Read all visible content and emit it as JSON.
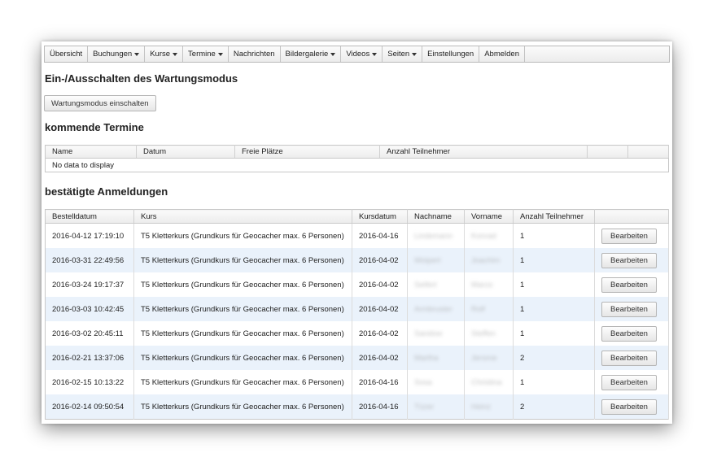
{
  "nav": {
    "items": [
      {
        "label": "Übersicht",
        "dropdown": false
      },
      {
        "label": "Buchungen",
        "dropdown": true
      },
      {
        "label": "Kurse",
        "dropdown": true
      },
      {
        "label": "Termine",
        "dropdown": true
      },
      {
        "label": "Nachrichten",
        "dropdown": false
      },
      {
        "label": "Bildergalerie",
        "dropdown": true
      },
      {
        "label": "Videos",
        "dropdown": true
      },
      {
        "label": "Seiten",
        "dropdown": true
      },
      {
        "label": "Einstellungen",
        "dropdown": false
      },
      {
        "label": "Abmelden",
        "dropdown": false
      }
    ]
  },
  "maintenance": {
    "heading": "Ein-/Ausschalten des Wartungsmodus",
    "button_label": "Wartungsmodus einschalten"
  },
  "upcoming": {
    "heading": "kommende Termine",
    "columns": [
      "Name",
      "Datum",
      "Freie Plätze",
      "Anzahl Teilnehmer",
      "",
      ""
    ],
    "empty_text": "No data to display"
  },
  "confirmed": {
    "heading": "bestätigte Anmeldungen",
    "columns": [
      "Bestelldatum",
      "Kurs",
      "Kursdatum",
      "Nachname",
      "Vorname",
      "Anzahl Teilnehmer",
      ""
    ],
    "action_label": "Bearbeiten",
    "rows": [
      {
        "bestelldatum": "2016-04-12 17:19:10",
        "kurs": "T5 Kletterkurs (Grundkurs für Geocacher max. 6 Personen)",
        "kursdatum": "2016-04-16",
        "nachname": "Lindemann",
        "vorname": "Konrad",
        "anzahl": "1"
      },
      {
        "bestelldatum": "2016-03-31 22:49:56",
        "kurs": "T5 Kletterkurs (Grundkurs für Geocacher max. 6 Personen)",
        "kursdatum": "2016-04-02",
        "nachname": "Wolpert",
        "vorname": "Joachim",
        "anzahl": "1"
      },
      {
        "bestelldatum": "2016-03-24 19:17:37",
        "kurs": "T5 Kletterkurs (Grundkurs für Geocacher max. 6 Personen)",
        "kursdatum": "2016-04-02",
        "nachname": "Seifert",
        "vorname": "Marco",
        "anzahl": "1"
      },
      {
        "bestelldatum": "2016-03-03 10:42:45",
        "kurs": "T5 Kletterkurs (Grundkurs für Geocacher max. 6 Personen)",
        "kursdatum": "2016-04-02",
        "nachname": "Armbruster",
        "vorname": "Rolf",
        "anzahl": "1"
      },
      {
        "bestelldatum": "2016-03-02 20:45:11",
        "kurs": "T5 Kletterkurs (Grundkurs für Geocacher max. 6 Personen)",
        "kursdatum": "2016-04-02",
        "nachname": "Sandow",
        "vorname": "Steffen",
        "anzahl": "1"
      },
      {
        "bestelldatum": "2016-02-21 13:37:06",
        "kurs": "T5 Kletterkurs (Grundkurs für Geocacher max. 6 Personen)",
        "kursdatum": "2016-04-02",
        "nachname": "Martha",
        "vorname": "Jerome",
        "anzahl": "2"
      },
      {
        "bestelldatum": "2016-02-15 10:13:22",
        "kurs": "T5 Kletterkurs (Grundkurs für Geocacher max. 6 Personen)",
        "kursdatum": "2016-04-16",
        "nachname": "Sosa",
        "vorname": "Christina",
        "anzahl": "1"
      },
      {
        "bestelldatum": "2016-02-14 09:50:54",
        "kurs": "T5 Kletterkurs (Grundkurs für Geocacher max. 6 Personen)",
        "kursdatum": "2016-04-16",
        "nachname": "Tüzer",
        "vorname": "Heinz",
        "anzahl": "2"
      }
    ]
  }
}
